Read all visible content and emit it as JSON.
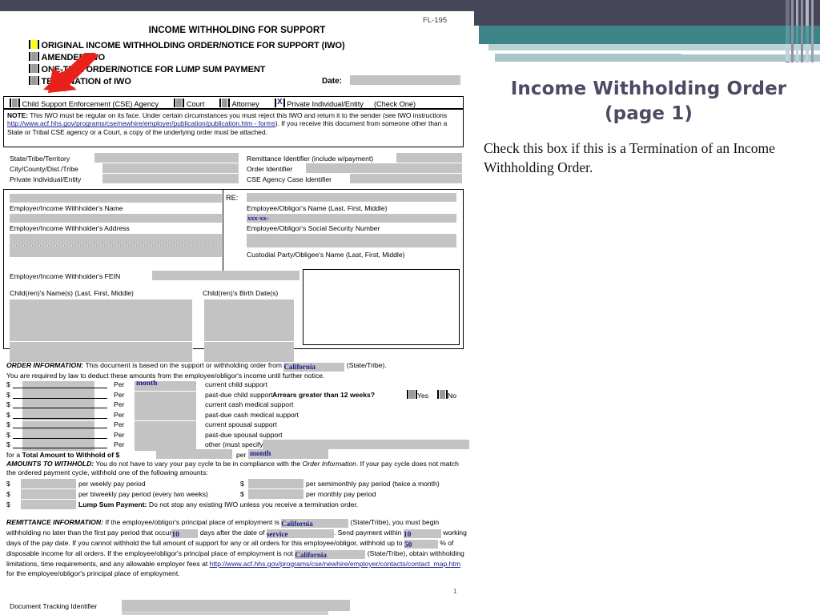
{
  "slide": {
    "title_line1": "Income Withholding Order",
    "title_line2": "(page 1)",
    "body": "Check this box if this is a Termination of an Income Withholding Order.",
    "accent_dark": "#464659",
    "accent_teal": "#3c8488",
    "accent_pale": "#b9d2d4",
    "highlight_yellow": "#ffff00",
    "arrow_color": "#e8211a",
    "field_shade": "#c3c3c3",
    "blue_ink": "#1a1a8c"
  },
  "form": {
    "form_number": "FL-195",
    "title": "INCOME WITHHOLDING FOR SUPPORT",
    "order_types": [
      {
        "label": "ORIGINAL INCOME WITHHOLDING ORDER/NOTICE FOR SUPPORT (IWO)",
        "checked": false,
        "highlight": "yellow"
      },
      {
        "label": "AMENDED IWO",
        "checked": false,
        "highlight": "none"
      },
      {
        "label": "ONE-TIME ORDER/NOTICE FOR LUMP SUM PAYMENT",
        "checked": false,
        "highlight": "none"
      },
      {
        "label": "TERMINATION of IWO",
        "checked": false,
        "highlight": "none"
      }
    ],
    "date_label": "Date:",
    "date_value": "",
    "sender_row": {
      "options": [
        {
          "label": "Child Support Enforcement (CSE) Agency",
          "checked": false
        },
        {
          "label": "Court",
          "checked": false
        },
        {
          "label": "Attorney",
          "checked": false
        },
        {
          "label": "Private Individual/Entity",
          "checked": true
        }
      ],
      "instruction": "(Check One)"
    },
    "note": {
      "prefix": "NOTE:",
      "text_1": "This IWO must be regular on its face. Under certain circumstances you must reject this IWO and return it to the sender (see IWO instructions ",
      "link": "http://www.acf.hhs.gov/programs/cse/newhire/employer/publication/publication.htm - forms",
      "text_2": "). If you receive this document from someone other than a State or Tribal CSE agency or a Court, a copy of the underlying order must be attached."
    },
    "identifiers_left": [
      {
        "label": "State/Tribe/Territory",
        "value": ""
      },
      {
        "label": "City/County/Dist./Tribe",
        "value": ""
      },
      {
        "label": "Private Individual/Entity",
        "value": ""
      }
    ],
    "identifiers_right": [
      {
        "label": "Remittance Identifier (include w/payment)",
        "value": ""
      },
      {
        "label": "Order Identifier",
        "value": ""
      },
      {
        "label": "CSE Agency Case Identifier",
        "value": ""
      }
    ],
    "parties": {
      "re_label": "RE:",
      "employer_name_label": "Employer/Income Withholder's Name",
      "employer_name_value": "",
      "employer_address_label": "Employer/Income Withholder's Address",
      "employer_address_value": "",
      "employer_fein_label": "Employer/Income Withholder's FEIN",
      "employer_fein_value": "",
      "employee_name_label": "Employee/Obligor's Name (Last, First, Middle)",
      "employee_name_value": "",
      "employee_ssn_label": "Employee/Obligor's Social Security Number",
      "employee_ssn_value": "xxx-xx-",
      "custodial_label": "Custodial Party/Obligee's Name (Last, First, Middle)",
      "custodial_value": "",
      "children_names_label": "Child(ren)'s Name(s) (Last, First, Middle)",
      "children_dob_label": "Child(ren)'s Birth Date(s)"
    },
    "order_information": {
      "heading": "ORDER INFORMATION:",
      "intro_1": "This document is based on the support or withholding order from",
      "state_value": "California",
      "intro_2": "(State/Tribe).",
      "intro_3": "You are required by law to deduct these amounts from the employee/obligor's income until further notice.",
      "rows": [
        {
          "amount": "",
          "per_label": "Per",
          "per_value": "month",
          "per_blue": true,
          "description": "current child support"
        },
        {
          "amount": "",
          "per_label": "Per",
          "per_value": "",
          "per_blue": false,
          "description": "past-due child support -"
        },
        {
          "amount": "",
          "per_label": "Per",
          "per_value": "",
          "per_blue": false,
          "description": "current cash medical support"
        },
        {
          "amount": "",
          "per_label": "Per",
          "per_value": "",
          "per_blue": false,
          "description": "past-due cash medical support"
        },
        {
          "amount": "",
          "per_label": "Per",
          "per_value": "",
          "per_blue": false,
          "description": "current spousal support"
        },
        {
          "amount": "",
          "per_label": "Per",
          "per_value": "",
          "per_blue": false,
          "description": "past-due spousal support"
        },
        {
          "amount": "",
          "per_label": "Per",
          "per_value": "",
          "per_blue": false,
          "description": "other (must specify)"
        }
      ],
      "arrears_question": "Arrears greater than 12 weeks?",
      "arrears_yes": "Yes",
      "arrears_no": "No",
      "total_prefix": "for a",
      "total_label": "Total Amount to Withhold",
      "total_of": "of $",
      "total_value": "",
      "total_per_label": "per",
      "total_per_value": "month"
    },
    "amounts_to_withhold": {
      "heading": "AMOUNTS TO WITHHOLD:",
      "text_1": "You do not have to vary your pay cycle to be in compliance with the",
      "italic_ref": "Order Information",
      "text_2": ". If your pay cycle does not match the ordered payment cycle, withhold one of the following amounts:",
      "weekly_value": "",
      "weekly_label": "per weekly pay period",
      "semimonthly_value": "",
      "semimonthly_label": "per semimonthly pay period (twice a month)",
      "biweekly_value": "",
      "biweekly_label": "per biweekly pay period (every two weeks)",
      "monthly_value": "",
      "monthly_label": "per monthly pay period",
      "lump_value": "",
      "lump_label": "Lump Sum Payment:",
      "lump_text": "Do not stop any existing IWO unless you receive a termination order."
    },
    "remittance_information": {
      "heading": "REMITTANCE INFORMATION:",
      "t1": "If the employee/obligor's principal place of employment is",
      "state_1": "California",
      "t2": "(State/Tribe), you must begin withholding no later than the first pay period that occur",
      "days_1": "10",
      "t3": "days after the date of",
      "service": "service",
      "t4": ". Send payment within",
      "days_2": "10",
      "t5": "working days of the pay date. If you cannot withhold the full amount of support for any or all orders for this employee/obligor, withhold up to",
      "percent": "50",
      "t6": "% of disposable income for all orders. If the employee/obligor's principal place of employment is not",
      "state_2": "California",
      "t7": "(State/Tribe), obtain withholding limitations, time requirements, and any allowable employer fees at",
      "link": "http://www.acf.hhs.gov/programs/cse/newhire/employer/contacts/contact_map.htm",
      "t8": "for the employee/obligor's principal place of employment."
    },
    "footer": {
      "page_number": "1",
      "tracking_label": "Document Tracking Identifier",
      "tracking_value": ""
    }
  }
}
